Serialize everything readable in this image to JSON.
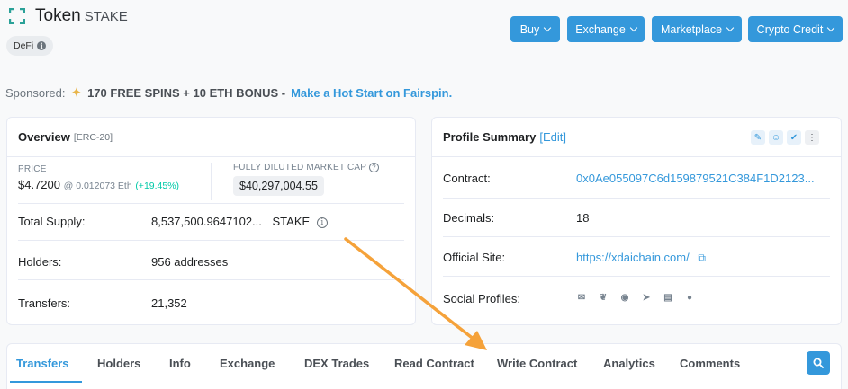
{
  "header": {
    "title": "Token",
    "symbol": "STAKE",
    "tag": "DeFi",
    "buttons": [
      "Buy",
      "Exchange",
      "Marketplace",
      "Crypto Credit"
    ]
  },
  "sponsored": {
    "label": "Sponsored:",
    "bold_text": "170 FREE SPINS + 10 ETH BONUS -",
    "link_text": "Make a Hot Start on Fairspin."
  },
  "overview": {
    "title": "Overview",
    "subtitle": "[ERC-20]",
    "price_label": "PRICE",
    "price": "$4.7200",
    "price_eth": "@ 0.012073 Eth",
    "price_change": "(+19.45%)",
    "mcap_label": "FULLY DILUTED MARKET CAP",
    "mcap": "$40,297,004.55",
    "rows": [
      {
        "label": "Total Supply:",
        "value": "8,537,500.9647102...",
        "unit": "STAKE"
      },
      {
        "label": "Holders:",
        "value": "956 addresses"
      },
      {
        "label": "Transfers:",
        "value": "21,352"
      }
    ]
  },
  "profile": {
    "title": "Profile Summary",
    "edit": "[Edit]",
    "rows": [
      {
        "label": "Contract:",
        "value": "0x0Ae055097C6d159879521C384F1D2123..."
      },
      {
        "label": "Decimals:",
        "value": "18"
      },
      {
        "label": "Official Site:",
        "value": "https://xdaichain.com/"
      },
      {
        "label": "Social Profiles:",
        "value": ""
      }
    ],
    "social_icons": [
      "email-icon",
      "twitter-icon",
      "github-icon",
      "telegram-icon",
      "whitepaper-icon",
      "coingecko-icon"
    ]
  },
  "tabs": [
    "Transfers",
    "Holders",
    "Info",
    "Exchange",
    "DEX Trades",
    "Read Contract",
    "Write Contract",
    "Analytics",
    "Comments"
  ],
  "colors": {
    "accent": "#3498db",
    "positive": "#00c9a7",
    "annotation_arrow": "#f5a23a"
  }
}
